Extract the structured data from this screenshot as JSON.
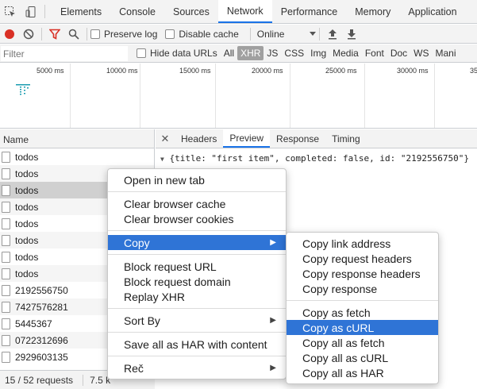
{
  "tabs": [
    "Elements",
    "Console",
    "Sources",
    "Network",
    "Performance",
    "Memory",
    "Application"
  ],
  "active_tab": "Network",
  "toolbar": {
    "preserve_log": "Preserve log",
    "disable_cache": "Disable cache",
    "throttle": "Online",
    "record_color": "#d93025",
    "filter_icon_color": "#d93025"
  },
  "filterbar": {
    "placeholder": "Filter",
    "hide_data_urls": "Hide data URLs",
    "types": [
      "All",
      "XHR",
      "JS",
      "CSS",
      "Img",
      "Media",
      "Font",
      "Doc",
      "WS",
      "Mani"
    ],
    "active_type": "XHR"
  },
  "timeline": {
    "ticks": [
      "5000 ms",
      "10000 ms",
      "15000 ms",
      "20000 ms",
      "25000 ms",
      "30000 ms",
      "35"
    ]
  },
  "left_panel": {
    "header": "Name",
    "rows": [
      "todos",
      "todos",
      "todos",
      "todos",
      "todos",
      "todos",
      "todos",
      "todos",
      "2192556750",
      "7427576281",
      "5445367",
      "0722312696",
      "2929603135"
    ],
    "status": "15 / 52 requests",
    "status_size": "7.5 k"
  },
  "right_panel": {
    "tabs": [
      "Headers",
      "Preview",
      "Response",
      "Timing"
    ],
    "active_tab": "Preview",
    "preview_line": "{title: \"first item\", completed: false, id: \"2192556750\"}"
  },
  "context_menu": {
    "items": [
      [
        "Open in new tab"
      ],
      [
        "Clear browser cache",
        "Clear browser cookies"
      ],
      [
        "Copy"
      ],
      [
        "Block request URL",
        "Block request domain",
        "Replay XHR"
      ],
      [
        "Sort By"
      ],
      [
        "Save all as HAR with content"
      ],
      [
        "Reč"
      ]
    ]
  },
  "submenu": {
    "items": [
      [
        "Copy link address",
        "Copy request headers",
        "Copy response headers",
        "Copy response"
      ],
      [
        "Copy as fetch",
        "Copy as cURL",
        "Copy all as fetch",
        "Copy all as cURL",
        "Copy all as HAR"
      ]
    ],
    "highlighted": "Copy as cURL"
  }
}
